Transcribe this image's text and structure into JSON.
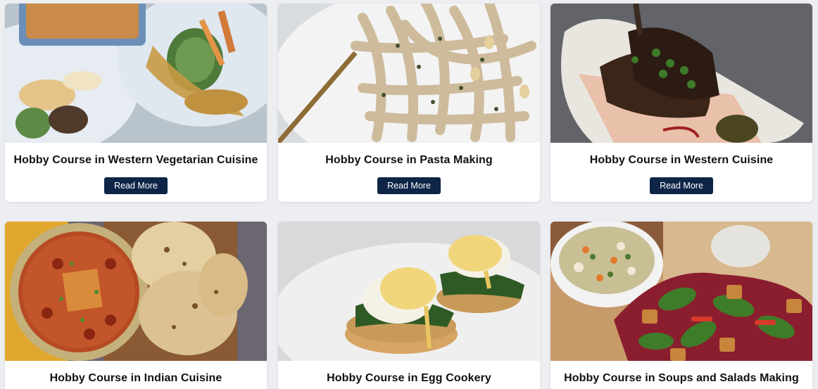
{
  "courses": [
    {
      "title": "Hobby Course in Western Vegetarian Cuisine",
      "button": "Read More",
      "image": "roasted-vegetables-photo"
    },
    {
      "title": "Hobby Course in Pasta Making",
      "button": "Read More",
      "image": "pesto-fettuccine-photo"
    },
    {
      "title": "Hobby Course in Western Cuisine",
      "button": "Read More",
      "image": "lamb-rack-photo"
    },
    {
      "title": "Hobby Course in Indian Cuisine",
      "button": "",
      "image": "curry-and-paratha-photo"
    },
    {
      "title": "Hobby Course in Egg Cookery",
      "button": "",
      "image": "eggs-benedict-photo"
    },
    {
      "title": "Hobby Course in Soups and Salads Making",
      "button": "",
      "image": "soup-and-salad-photo"
    }
  ],
  "colors": {
    "page_background": "#eceef1",
    "card_background": "#ffffff",
    "button_background": "#0e2547",
    "button_text": "#ffffff",
    "title_text": "#111111"
  }
}
